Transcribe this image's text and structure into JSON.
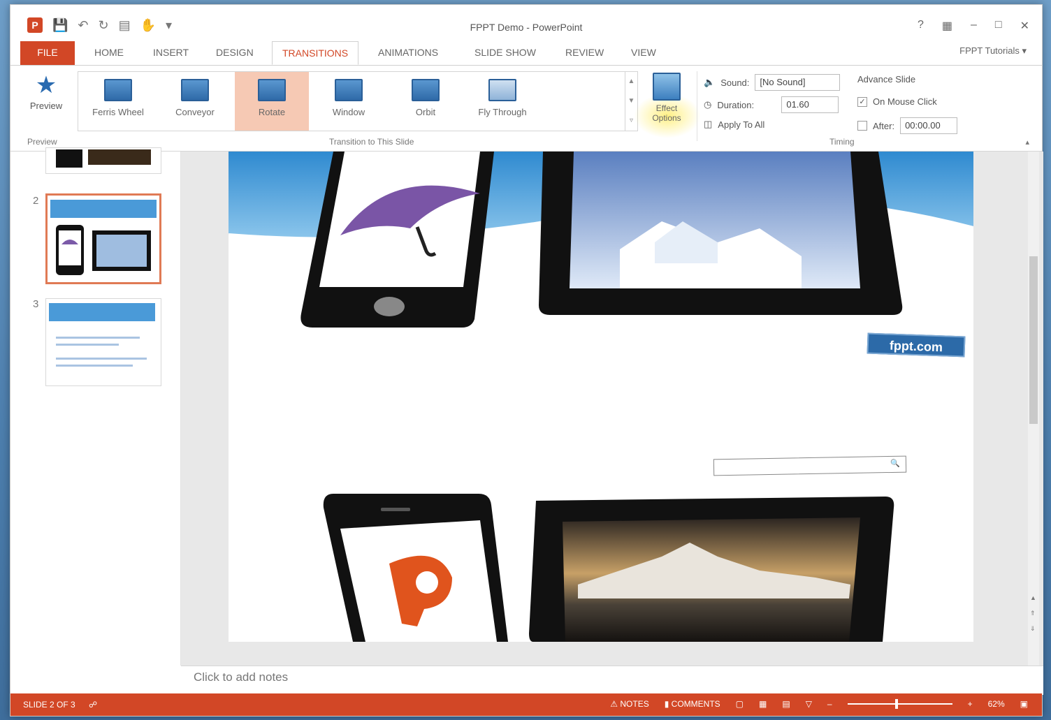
{
  "app": {
    "title": "FPPT Demo - PowerPoint",
    "account": "FPPT Tutorials ▾",
    "help": "?",
    "minimize": "–",
    "maximize": "□",
    "close": "✕"
  },
  "tabs": [
    "FILE",
    "HOME",
    "INSERT",
    "DESIGN",
    "TRANSITIONS",
    "ANIMATIONS",
    "SLIDE SHOW",
    "REVIEW",
    "VIEW"
  ],
  "active_tab": "TRANSITIONS",
  "ribbon": {
    "preview": {
      "label": "Preview",
      "group": "Preview"
    },
    "gallery_group": "Transition to This Slide",
    "transitions": [
      "Ferris Wheel",
      "Conveyor",
      "Rotate",
      "Window",
      "Orbit",
      "Fly Through"
    ],
    "selected_transition": "Rotate",
    "effect_options": "Effect Options",
    "timing": {
      "group": "Timing",
      "sound_label": "Sound:",
      "sound_value": "[No Sound]",
      "duration_label": "Duration:",
      "duration_value": "01.60",
      "apply_all": "Apply To All",
      "advance_title": "Advance Slide",
      "on_mouse_click": "On Mouse Click",
      "on_mouse_click_checked": true,
      "after_label": "After:",
      "after_value": "00:00.00",
      "after_checked": false
    }
  },
  "thumbnails": [
    {
      "num": "2",
      "selected": true
    },
    {
      "num": "3",
      "selected": false
    }
  ],
  "slide": {
    "badge": "fppt.com"
  },
  "notes_placeholder": "Click to add notes",
  "status": {
    "slide_info": "SLIDE 2 OF 3",
    "notes": "NOTES",
    "comments": "COMMENTS",
    "zoom": "62%"
  },
  "colors": {
    "accent": "#d24726",
    "selected_transition": "#f6c9b4"
  }
}
